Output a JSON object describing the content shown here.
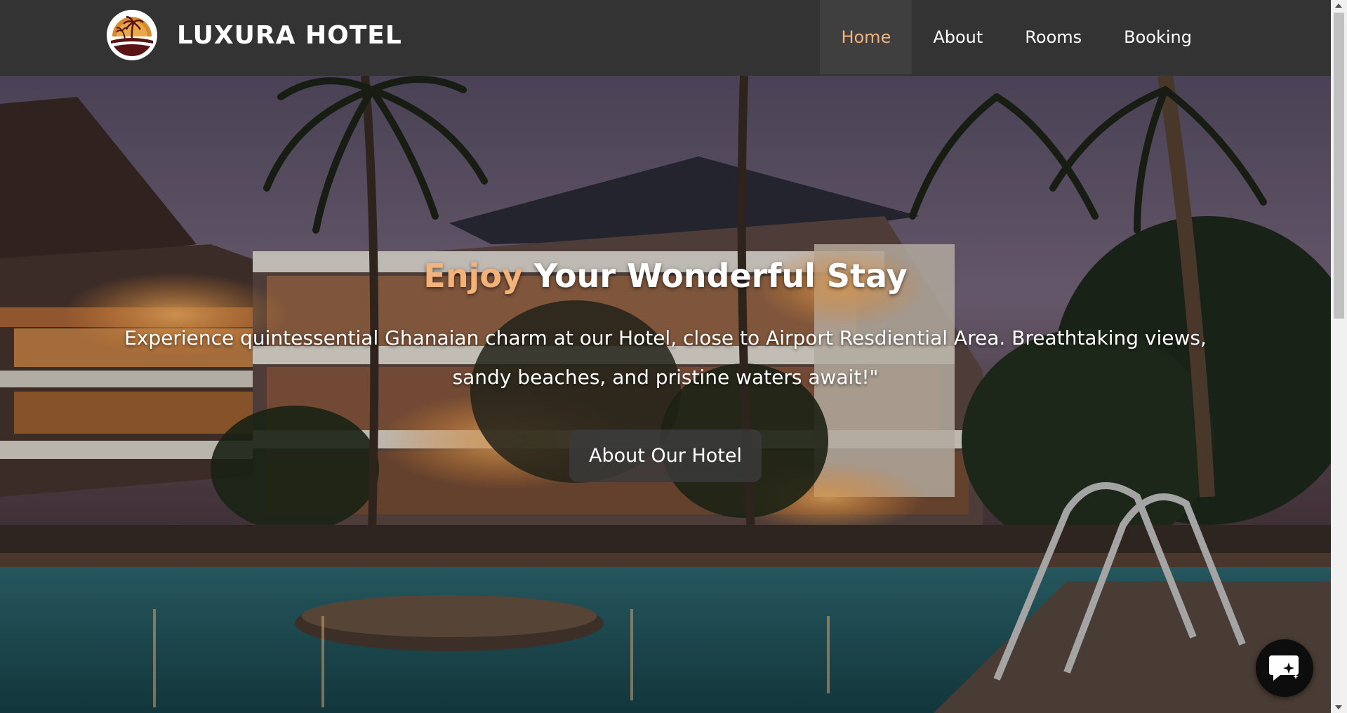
{
  "brand": {
    "name": "LUXURA HOTEL",
    "logo_icon": "palm-sunset-logo"
  },
  "nav": {
    "items": [
      {
        "label": "Home",
        "active": true
      },
      {
        "label": "About",
        "active": false
      },
      {
        "label": "Rooms",
        "active": false
      },
      {
        "label": "Booking",
        "active": false
      }
    ]
  },
  "hero": {
    "title_accent": "Enjoy",
    "title_rest": " Your Wonderful Stay",
    "text": "Experience quintessential Ghanaian charm at our Hotel, close to Airport Resdiential Area. Breathtaking views, sandy beaches, and pristine waters await!\"",
    "button_label": "About Our Hotel",
    "background_icon": "resort-pool-photo"
  },
  "chat": {
    "icon": "chat-sparkle-icon"
  },
  "colors": {
    "nav_bg": "#333333",
    "accent": "#f2b27a",
    "button_bg": "#3a3a3a"
  }
}
